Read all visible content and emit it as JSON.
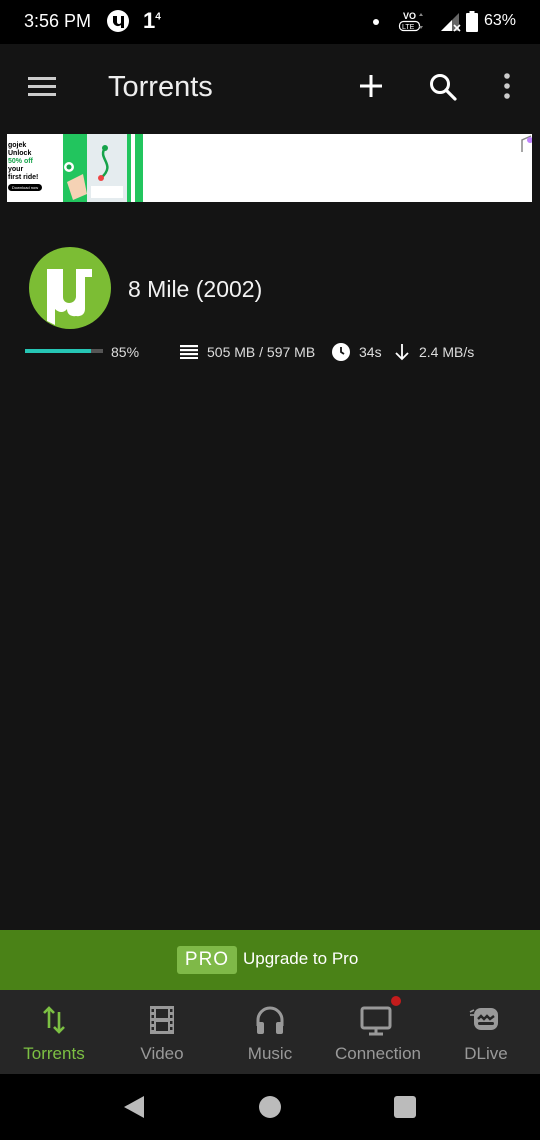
{
  "status_bar": {
    "time": "3:56 PM",
    "notification_num": "1",
    "notification_sup": "4",
    "volte_label": "VO LTE",
    "battery": "63%",
    "icons": [
      "utorrent-icon",
      "dot-icon",
      "volte-icon",
      "signal-icon",
      "battery-icon"
    ]
  },
  "app_bar": {
    "title": "Torrents",
    "icons": [
      "menu-icon",
      "add-icon",
      "search-icon",
      "more-icon"
    ]
  },
  "ad": {
    "brand": "gojek",
    "headline_1": "Unlock",
    "headline_2": "50% off",
    "headline_3": "your",
    "headline_4": "first ride!",
    "button": "Download now"
  },
  "torrent": {
    "name": "8 Mile (2002)",
    "progress": 0.85,
    "progress_label": "85%",
    "size": "505 MB / 597 MB",
    "eta": "34s",
    "speed": "2.4 MB/s"
  },
  "upgrade": {
    "badge": "PRO",
    "text": "Upgrade to Pro"
  },
  "bottom_nav": {
    "items": [
      {
        "label": "Torrents",
        "icon": "transfer-arrows-icon",
        "active": true
      },
      {
        "label": "Video",
        "icon": "film-icon",
        "active": false
      },
      {
        "label": "Music",
        "icon": "headphones-icon",
        "active": false
      },
      {
        "label": "Connection",
        "icon": "monitor-icon",
        "active": false
      },
      {
        "label": "DLive",
        "icon": "dlive-icon",
        "active": false
      }
    ]
  },
  "colors": {
    "accent_green": "#7cc043",
    "upgrade_bg": "#4a8217",
    "progress": "#26c6b5",
    "notification_dot": "#c41c1c"
  }
}
